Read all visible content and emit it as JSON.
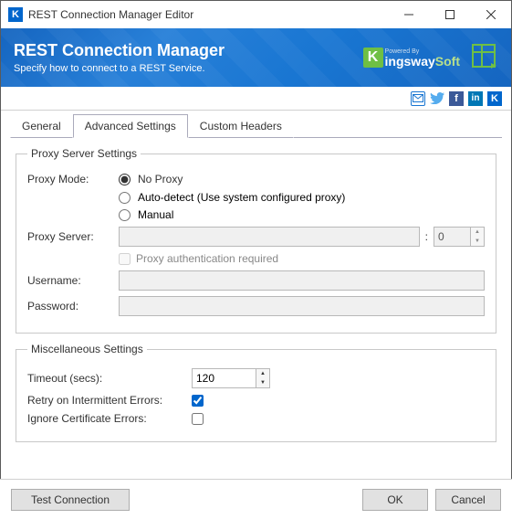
{
  "window": {
    "title": "REST Connection Manager Editor"
  },
  "banner": {
    "title": "REST Connection Manager",
    "subtitle": "Specify how to connect to a REST Service.",
    "powered_by": "Powered By",
    "brand_k": "K",
    "brand_ingsway": "ingsway",
    "brand_soft": "Soft"
  },
  "tabs": {
    "general": "General",
    "advanced": "Advanced Settings",
    "custom": "Custom Headers"
  },
  "proxy": {
    "legend": "Proxy Server Settings",
    "mode_label": "Proxy Mode:",
    "opt_no_proxy": "No Proxy",
    "opt_auto": "Auto-detect (Use system configured proxy)",
    "opt_manual": "Manual",
    "server_label": "Proxy Server:",
    "server_value": "",
    "port_sep": ":",
    "port_value": "0",
    "auth_label": "Proxy authentication required",
    "username_label": "Username:",
    "username_value": "",
    "password_label": "Password:",
    "password_value": ""
  },
  "misc": {
    "legend": "Miscellaneous Settings",
    "timeout_label": "Timeout (secs):",
    "timeout_value": "120",
    "retry_label": "Retry on Intermittent Errors:",
    "ignore_label": "Ignore Certificate Errors:"
  },
  "footer": {
    "test": "Test Connection",
    "ok": "OK",
    "cancel": "Cancel"
  }
}
